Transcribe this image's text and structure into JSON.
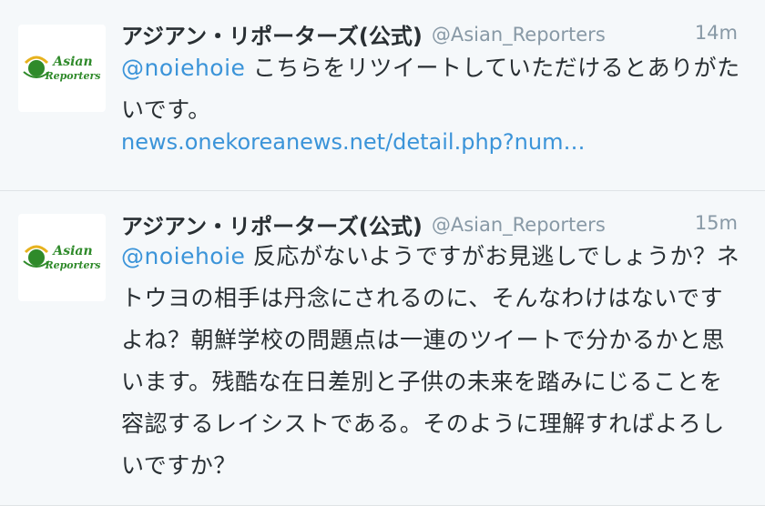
{
  "tweets": [
    {
      "avatar": {
        "line1": "Asian",
        "line2": "Reporters"
      },
      "fullname": "アジアン・リポーターズ(公式)",
      "username": "@Asian_Reporters",
      "time": "14m",
      "mention": "@noiehoie",
      "text": "こちらをリツイートしていただけるとありがたいです。",
      "link": "news.onekoreanews.net/detail.php?num…"
    },
    {
      "avatar": {
        "line1": "Asian",
        "line2": "Reporters"
      },
      "fullname": "アジアン・リポーターズ(公式)",
      "username": "@Asian_Reporters",
      "time": "15m",
      "mention": "@noiehoie",
      "text": "反応がないようですがお見逃しでしょうか？ネトウヨの相手は丹念にされるのに、そんなわけはないですよね？朝鮮学校の問題点は一連のツイートで分かるかと思います。残酷な在日差別と子供の未来を踏みにじることを容認するレイシストである。そのように理解すればよろしいですか？"
    }
  ]
}
